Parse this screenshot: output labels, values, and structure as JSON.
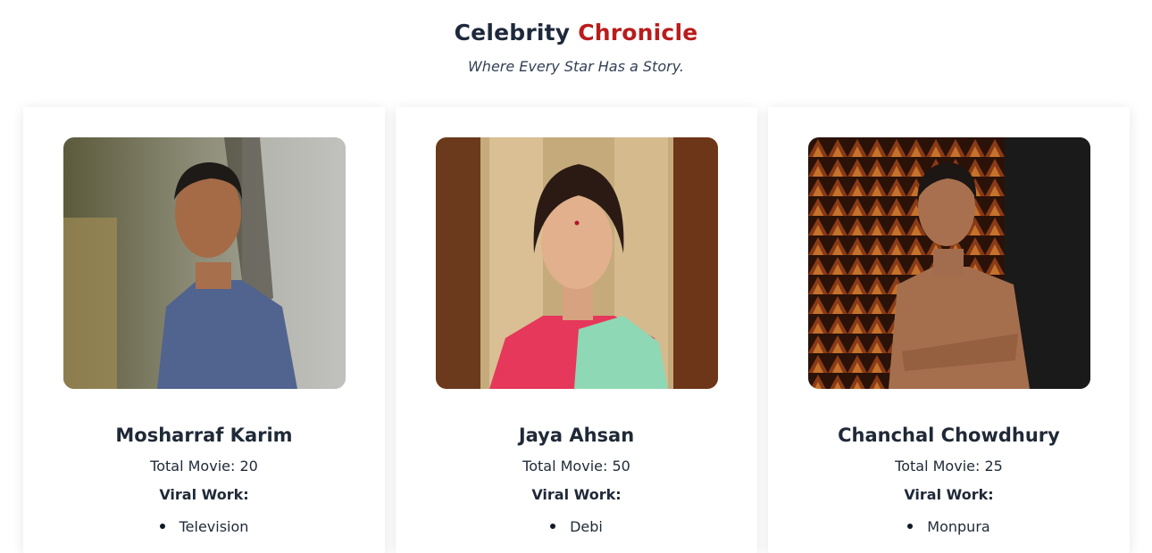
{
  "header": {
    "title_main": "Celebrity",
    "title_accent": "Chronicle",
    "subtitle": "Where Every Star Has a Story."
  },
  "cards": [
    {
      "name": "Mosharraf Karim",
      "total_movies": "Total Movie: 20",
      "viral_label": "Viral Work:",
      "works": [
        "Television"
      ]
    },
    {
      "name": "Jaya Ahsan",
      "total_movies": "Total Movie: 50",
      "viral_label": "Viral Work:",
      "works": [
        "Debi"
      ]
    },
    {
      "name": "Chanchal Chowdhury",
      "total_movies": "Total Movie: 25",
      "viral_label": "Viral Work:",
      "works": [
        "Monpura"
      ]
    }
  ],
  "colors": {
    "accent": "#b91c1c",
    "title": "#1e293b",
    "text": "#1f2937"
  }
}
